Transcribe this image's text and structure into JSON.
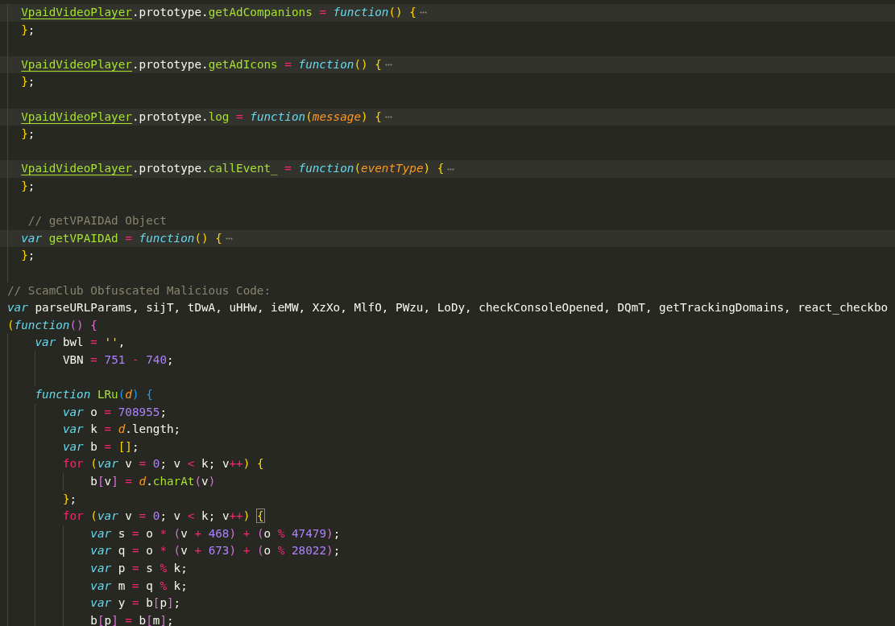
{
  "editor": {
    "lines": [
      {
        "kind": "code",
        "folded": true,
        "tokens": [
          {
            "text": "  VpaidVideoPlayer",
            "kind": "cls"
          },
          {
            "text": ".prototype.",
            "kind": "p"
          },
          {
            "text": "getAdCompanions ",
            "kind": "fn"
          },
          {
            "text": "= ",
            "kind": "op"
          },
          {
            "text": "function",
            "kind": "st"
          },
          {
            "text": "() {",
            "kind": "b1"
          }
        ]
      },
      {
        "kind": "code",
        "folded": false,
        "tokens": [
          {
            "text": "  }",
            "kind": "b1"
          },
          {
            "text": ";",
            "kind": "p"
          }
        ]
      },
      {
        "kind": "blank"
      },
      {
        "kind": "code",
        "folded": true,
        "tokens": [
          {
            "text": "  VpaidVideoPlayer",
            "kind": "cls"
          },
          {
            "text": ".prototype.",
            "kind": "p"
          },
          {
            "text": "getAdIcons ",
            "kind": "fn"
          },
          {
            "text": "= ",
            "kind": "op"
          },
          {
            "text": "function",
            "kind": "st"
          },
          {
            "text": "() {",
            "kind": "b1"
          }
        ]
      },
      {
        "kind": "code",
        "folded": false,
        "tokens": [
          {
            "text": "  }",
            "kind": "b1"
          },
          {
            "text": ";",
            "kind": "p"
          }
        ]
      },
      {
        "kind": "blank"
      },
      {
        "kind": "code",
        "folded": true,
        "tokens": [
          {
            "text": "  VpaidVideoPlayer",
            "kind": "cls"
          },
          {
            "text": ".prototype.",
            "kind": "p"
          },
          {
            "text": "log ",
            "kind": "fn"
          },
          {
            "text": "= ",
            "kind": "op"
          },
          {
            "text": "function",
            "kind": "st"
          },
          {
            "text": "(",
            "kind": "b1"
          },
          {
            "text": "message",
            "kind": "par"
          },
          {
            "text": ") {",
            "kind": "b1"
          }
        ]
      },
      {
        "kind": "code",
        "folded": false,
        "tokens": [
          {
            "text": "  }",
            "kind": "b1"
          },
          {
            "text": ";",
            "kind": "p"
          }
        ]
      },
      {
        "kind": "blank"
      },
      {
        "kind": "code",
        "folded": true,
        "tokens": [
          {
            "text": "  VpaidVideoPlayer",
            "kind": "cls"
          },
          {
            "text": ".prototype.",
            "kind": "p"
          },
          {
            "text": "callEvent_ ",
            "kind": "fn"
          },
          {
            "text": "= ",
            "kind": "op"
          },
          {
            "text": "function",
            "kind": "st"
          },
          {
            "text": "(",
            "kind": "b1"
          },
          {
            "text": "eventType",
            "kind": "par"
          },
          {
            "text": ") {",
            "kind": "b1"
          }
        ]
      },
      {
        "kind": "code",
        "folded": false,
        "tokens": [
          {
            "text": "  }",
            "kind": "b1"
          },
          {
            "text": ";",
            "kind": "p"
          }
        ]
      },
      {
        "kind": "blank"
      },
      {
        "kind": "code",
        "folded": false,
        "tokens": [
          {
            "text": "   // getVPAIDAd Object",
            "kind": "cm"
          }
        ]
      },
      {
        "kind": "code",
        "folded": true,
        "tokens": [
          {
            "text": "  var ",
            "kind": "st"
          },
          {
            "text": "getVPAIDAd ",
            "kind": "fn"
          },
          {
            "text": "= ",
            "kind": "op"
          },
          {
            "text": "function",
            "kind": "st"
          },
          {
            "text": "() {",
            "kind": "b1"
          }
        ]
      },
      {
        "kind": "code",
        "folded": false,
        "tokens": [
          {
            "text": "  }",
            "kind": "b1"
          },
          {
            "text": ";",
            "kind": "p"
          }
        ]
      },
      {
        "kind": "blank"
      },
      {
        "kind": "code",
        "folded": false,
        "tokens": [
          {
            "text": "// ScamClub Obfuscated Malicious Code:",
            "kind": "cm"
          }
        ]
      },
      {
        "kind": "code",
        "folded": false,
        "tokens": [
          {
            "text": "var ",
            "kind": "st"
          },
          {
            "text": "parseURLParams, sijT, tDwA, uHHw, ieMW, XzXo, MlfO, PWzu, LoDy, checkConsoleOpened, DQmT, getTrackingDomains, react_checkbo",
            "kind": "p"
          }
        ]
      },
      {
        "kind": "code",
        "folded": false,
        "tokens": [
          {
            "text": "(",
            "kind": "b1"
          },
          {
            "text": "function",
            "kind": "st"
          },
          {
            "text": "() {",
            "kind": "b2"
          }
        ]
      },
      {
        "kind": "code",
        "folded": false,
        "tokens": [
          {
            "text": "    var ",
            "kind": "st"
          },
          {
            "text": "bwl ",
            "kind": "p"
          },
          {
            "text": "= ",
            "kind": "op"
          },
          {
            "text": "''",
            "kind": "str"
          },
          {
            "text": ",",
            "kind": "p"
          }
        ]
      },
      {
        "kind": "code",
        "folded": false,
        "tokens": [
          {
            "text": "        VBN ",
            "kind": "p"
          },
          {
            "text": "= ",
            "kind": "op"
          },
          {
            "text": "751 ",
            "kind": "num"
          },
          {
            "text": "- ",
            "kind": "op"
          },
          {
            "text": "740",
            "kind": "num"
          },
          {
            "text": ";",
            "kind": "p"
          }
        ]
      },
      {
        "kind": "blank"
      },
      {
        "kind": "code",
        "folded": false,
        "tokens": [
          {
            "text": "    function ",
            "kind": "st"
          },
          {
            "text": "LRu",
            "kind": "fn"
          },
          {
            "text": "(",
            "kind": "b3"
          },
          {
            "text": "d",
            "kind": "par"
          },
          {
            "text": ") {",
            "kind": "b3"
          }
        ]
      },
      {
        "kind": "code",
        "folded": false,
        "tokens": [
          {
            "text": "        var ",
            "kind": "st"
          },
          {
            "text": "o ",
            "kind": "p"
          },
          {
            "text": "= ",
            "kind": "op"
          },
          {
            "text": "708955",
            "kind": "num"
          },
          {
            "text": ";",
            "kind": "p"
          }
        ]
      },
      {
        "kind": "code",
        "folded": false,
        "tokens": [
          {
            "text": "        var ",
            "kind": "st"
          },
          {
            "text": "k ",
            "kind": "p"
          },
          {
            "text": "= ",
            "kind": "op"
          },
          {
            "text": "d",
            "kind": "par"
          },
          {
            "text": ".length;",
            "kind": "p"
          }
        ]
      },
      {
        "kind": "code",
        "folded": false,
        "tokens": [
          {
            "text": "        var ",
            "kind": "st"
          },
          {
            "text": "b ",
            "kind": "p"
          },
          {
            "text": "= ",
            "kind": "op"
          },
          {
            "text": "[]",
            "kind": "b1"
          },
          {
            "text": ";",
            "kind": "p"
          }
        ]
      },
      {
        "kind": "code",
        "folded": false,
        "tokens": [
          {
            "text": "        for ",
            "kind": "kw"
          },
          {
            "text": "(",
            "kind": "b1"
          },
          {
            "text": "var ",
            "kind": "st"
          },
          {
            "text": "v ",
            "kind": "p"
          },
          {
            "text": "= ",
            "kind": "op"
          },
          {
            "text": "0",
            "kind": "num"
          },
          {
            "text": "; v ",
            "kind": "p"
          },
          {
            "text": "< ",
            "kind": "op"
          },
          {
            "text": "k; v",
            "kind": "p"
          },
          {
            "text": "++",
            "kind": "op"
          },
          {
            "text": ") ",
            "kind": "b1"
          },
          {
            "text": "{",
            "kind": "b1"
          }
        ]
      },
      {
        "kind": "code",
        "folded": false,
        "tokens": [
          {
            "text": "            b",
            "kind": "p"
          },
          {
            "text": "[",
            "kind": "b2"
          },
          {
            "text": "v",
            "kind": "p"
          },
          {
            "text": "] ",
            "kind": "b2"
          },
          {
            "text": "= ",
            "kind": "op"
          },
          {
            "text": "d",
            "kind": "par"
          },
          {
            "text": ".",
            "kind": "p"
          },
          {
            "text": "charAt",
            "kind": "fn"
          },
          {
            "text": "(",
            "kind": "b2"
          },
          {
            "text": "v",
            "kind": "p"
          },
          {
            "text": ")",
            "kind": "b2"
          }
        ]
      },
      {
        "kind": "code",
        "folded": false,
        "tokens": [
          {
            "text": "        }",
            "kind": "b1"
          },
          {
            "text": ";",
            "kind": "p"
          }
        ]
      },
      {
        "kind": "code",
        "folded": false,
        "tokens": [
          {
            "text": "        for ",
            "kind": "kw"
          },
          {
            "text": "(",
            "kind": "b1"
          },
          {
            "text": "var ",
            "kind": "st"
          },
          {
            "text": "v ",
            "kind": "p"
          },
          {
            "text": "= ",
            "kind": "op"
          },
          {
            "text": "0",
            "kind": "num"
          },
          {
            "text": "; v ",
            "kind": "p"
          },
          {
            "text": "< ",
            "kind": "op"
          },
          {
            "text": "k; v",
            "kind": "p"
          },
          {
            "text": "++",
            "kind": "op"
          },
          {
            "text": ") ",
            "kind": "b1"
          },
          {
            "text": "{",
            "kind": "match"
          }
        ]
      },
      {
        "kind": "code",
        "folded": false,
        "tokens": [
          {
            "text": "            var ",
            "kind": "st"
          },
          {
            "text": "s ",
            "kind": "p"
          },
          {
            "text": "= ",
            "kind": "op"
          },
          {
            "text": "o ",
            "kind": "p"
          },
          {
            "text": "* ",
            "kind": "op"
          },
          {
            "text": "(",
            "kind": "b2"
          },
          {
            "text": "v ",
            "kind": "p"
          },
          {
            "text": "+ ",
            "kind": "op"
          },
          {
            "text": "468",
            "kind": "num"
          },
          {
            "text": ") ",
            "kind": "b2"
          },
          {
            "text": "+ ",
            "kind": "op"
          },
          {
            "text": "(",
            "kind": "b2"
          },
          {
            "text": "o ",
            "kind": "p"
          },
          {
            "text": "% ",
            "kind": "op"
          },
          {
            "text": "47479",
            "kind": "num"
          },
          {
            "text": ")",
            "kind": "b2"
          },
          {
            "text": ";",
            "kind": "p"
          }
        ]
      },
      {
        "kind": "code",
        "folded": false,
        "tokens": [
          {
            "text": "            var ",
            "kind": "st"
          },
          {
            "text": "q ",
            "kind": "p"
          },
          {
            "text": "= ",
            "kind": "op"
          },
          {
            "text": "o ",
            "kind": "p"
          },
          {
            "text": "* ",
            "kind": "op"
          },
          {
            "text": "(",
            "kind": "b2"
          },
          {
            "text": "v ",
            "kind": "p"
          },
          {
            "text": "+ ",
            "kind": "op"
          },
          {
            "text": "673",
            "kind": "num"
          },
          {
            "text": ") ",
            "kind": "b2"
          },
          {
            "text": "+ ",
            "kind": "op"
          },
          {
            "text": "(",
            "kind": "b2"
          },
          {
            "text": "o ",
            "kind": "p"
          },
          {
            "text": "% ",
            "kind": "op"
          },
          {
            "text": "28022",
            "kind": "num"
          },
          {
            "text": ")",
            "kind": "b2"
          },
          {
            "text": ";",
            "kind": "p"
          }
        ]
      },
      {
        "kind": "code",
        "folded": false,
        "tokens": [
          {
            "text": "            var ",
            "kind": "st"
          },
          {
            "text": "p ",
            "kind": "p"
          },
          {
            "text": "= ",
            "kind": "op"
          },
          {
            "text": "s ",
            "kind": "p"
          },
          {
            "text": "% ",
            "kind": "op"
          },
          {
            "text": "k;",
            "kind": "p"
          }
        ]
      },
      {
        "kind": "code",
        "folded": false,
        "tokens": [
          {
            "text": "            var ",
            "kind": "st"
          },
          {
            "text": "m ",
            "kind": "p"
          },
          {
            "text": "= ",
            "kind": "op"
          },
          {
            "text": "q ",
            "kind": "p"
          },
          {
            "text": "% ",
            "kind": "op"
          },
          {
            "text": "k;",
            "kind": "p"
          }
        ]
      },
      {
        "kind": "code",
        "folded": false,
        "tokens": [
          {
            "text": "            var ",
            "kind": "st"
          },
          {
            "text": "y ",
            "kind": "p"
          },
          {
            "text": "= ",
            "kind": "op"
          },
          {
            "text": "b",
            "kind": "p"
          },
          {
            "text": "[",
            "kind": "b2"
          },
          {
            "text": "p",
            "kind": "p"
          },
          {
            "text": "]",
            "kind": "b2"
          },
          {
            "text": ";",
            "kind": "p"
          }
        ]
      },
      {
        "kind": "code",
        "folded": false,
        "tokens": [
          {
            "text": "            b",
            "kind": "p"
          },
          {
            "text": "[",
            "kind": "b2"
          },
          {
            "text": "p",
            "kind": "p"
          },
          {
            "text": "] ",
            "kind": "b2"
          },
          {
            "text": "= ",
            "kind": "op"
          },
          {
            "text": "b",
            "kind": "p"
          },
          {
            "text": "[",
            "kind": "b2"
          },
          {
            "text": "m",
            "kind": "p"
          },
          {
            "text": "]",
            "kind": "b2"
          },
          {
            "text": ";",
            "kind": "p"
          }
        ]
      }
    ]
  }
}
